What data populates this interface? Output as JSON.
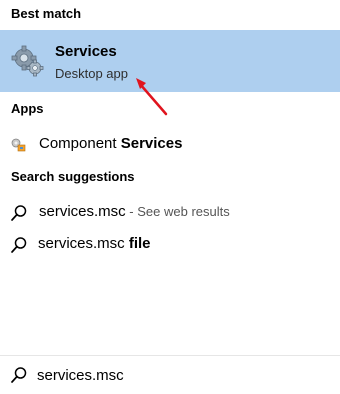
{
  "best_match": {
    "heading": "Best match",
    "title": "Services",
    "subtitle": "Desktop app",
    "icon": "services-gear-icon"
  },
  "apps": {
    "heading": "Apps",
    "items": [
      {
        "prefix": "Component ",
        "bold": "Services",
        "icon": "component-services-icon"
      }
    ]
  },
  "suggestions": {
    "heading": "Search suggestions",
    "items": [
      {
        "text": "services.msc",
        "hint": " - See web results",
        "icon": "search-icon"
      },
      {
        "text": "services.msc ",
        "bold": "file",
        "icon": "search-icon"
      }
    ]
  },
  "search": {
    "value": "services.msc",
    "icon": "search-icon"
  },
  "colors": {
    "selected_background": "#aecfef",
    "annotation_arrow": "#e0141e"
  }
}
